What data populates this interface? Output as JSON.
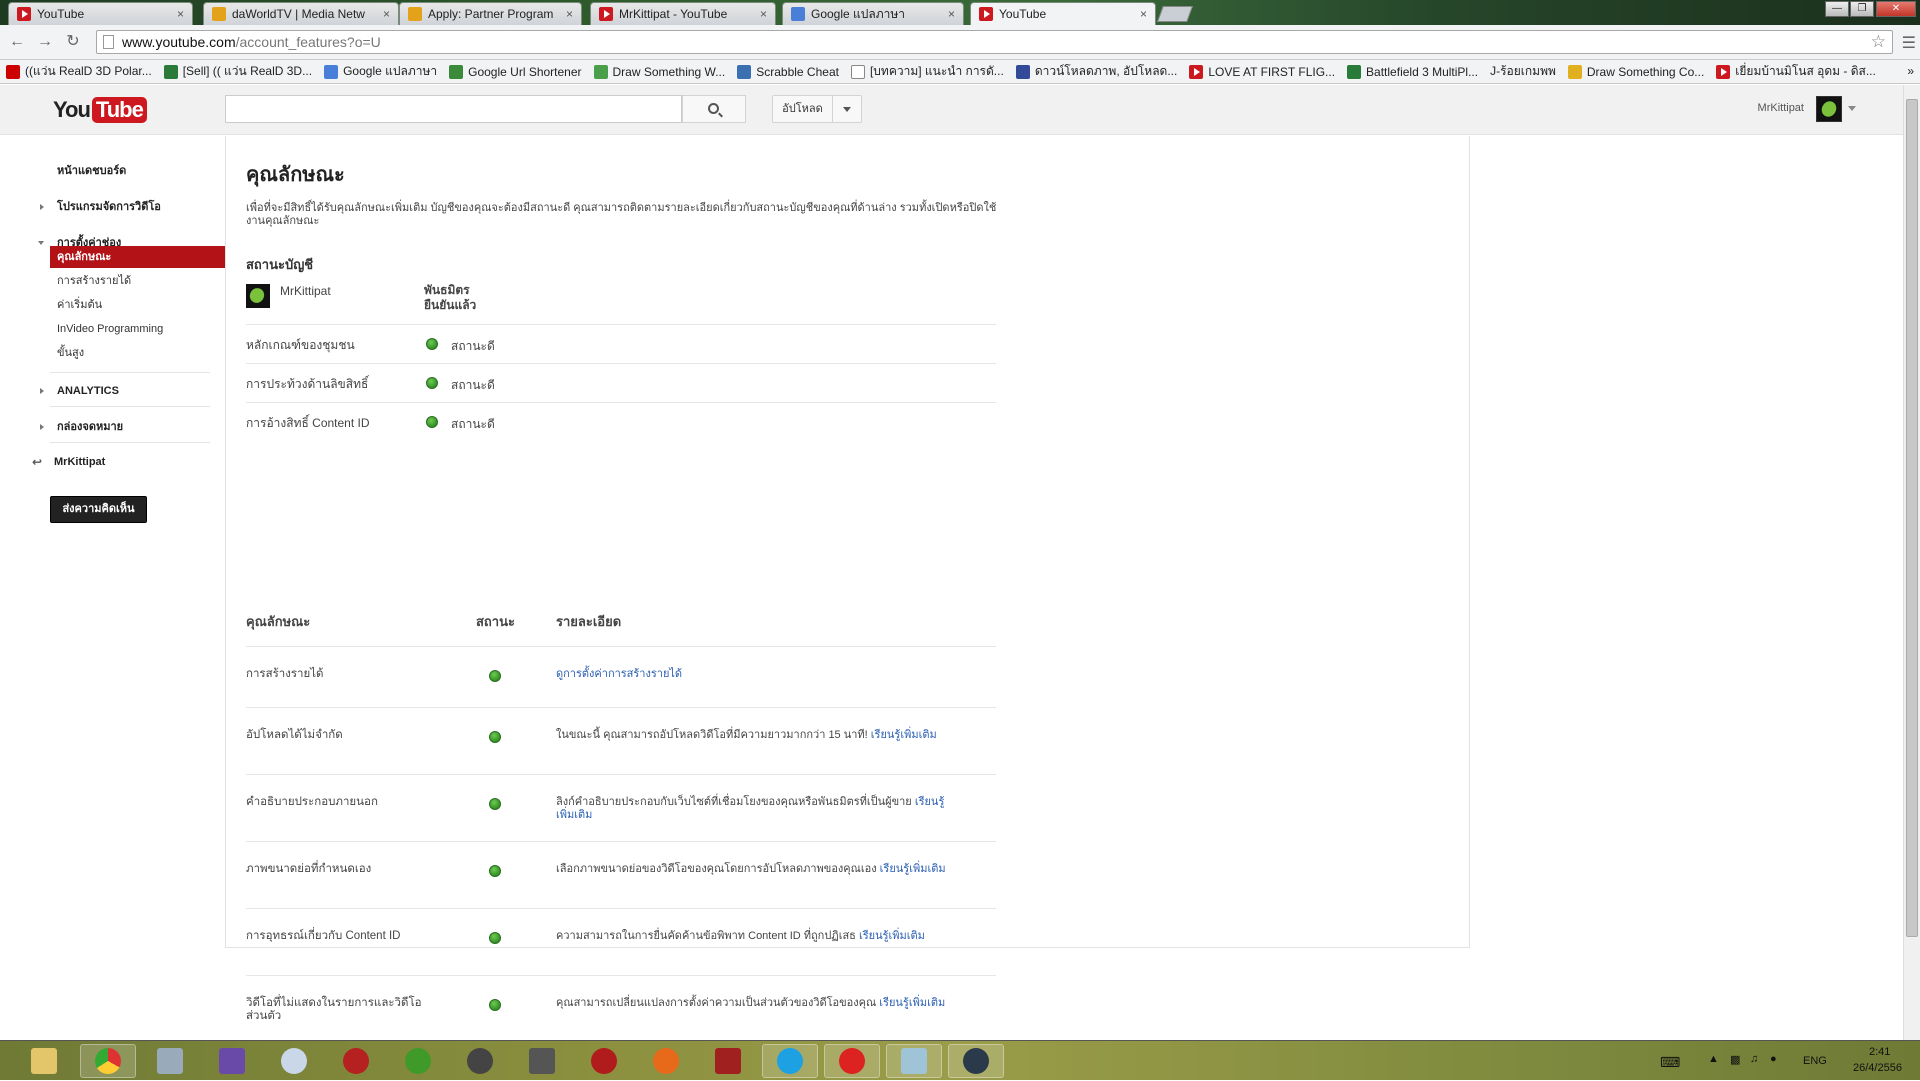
{
  "browser": {
    "tabs": [
      {
        "title": "YouTube",
        "favicon": "youtube-icon",
        "active": false
      },
      {
        "title": "daWorldTV | Media Netw",
        "favicon": "play-icon",
        "active": false
      },
      {
        "title": "Apply: Partner Program",
        "favicon": "play-icon",
        "active": false
      },
      {
        "title": "MrKittipat - YouTube",
        "favicon": "youtube-icon",
        "active": false
      },
      {
        "title": "Google แปลภาษา",
        "favicon": "google-translate-icon",
        "active": false
      },
      {
        "title": "YouTube",
        "favicon": "youtube-icon",
        "active": true
      }
    ],
    "tab_close": "×",
    "window_controls": {
      "minimize": "—",
      "maximize": "❐",
      "close": "✕"
    },
    "url_host": "www.youtube.com",
    "url_path": "/account_features?o=U",
    "bookmarks": [
      "((แว่น RealD 3D Polar...",
      "[Sell] (( แว่น RealD 3D...",
      "Google แปลภาษา",
      "Google Url Shortener",
      "Draw Something W...",
      "Scrabble Cheat",
      "[บทความ] แนะนำ การดั...",
      "ดาวน์โหลดภาพ, อัปโหลด...",
      "LOVE AT FIRST FLIG...",
      "Battlefield 3 MultiPl...",
      "J-ร้อยเกมพพ",
      "Draw Something Co...",
      "เยี่ยมบ้านมิโนส อุดม - ดิส..."
    ],
    "bookmarks_more": "»"
  },
  "youtube": {
    "logo_you": "You",
    "logo_tube": "Tube",
    "upload_label": "อัปโหลด",
    "username": "MrKittipat"
  },
  "sidebar": {
    "dashboard": "หน้าแดชบอร์ด",
    "video_manager": "โปรแกรมจัดการวิดีโอ",
    "channel_settings": "การตั้งค่าช่อง",
    "sub_items": [
      "คุณลักษณะ",
      "การสร้างรายได้",
      "ค่าเริ่มต้น",
      "InVideo Programming",
      "ขั้นสูง"
    ],
    "analytics": "ANALYTICS",
    "inbox": "กล่องจดหมาย",
    "back_user": "MrKittipat",
    "feedback": "ส่งความคิดเห็น"
  },
  "content": {
    "title": "คุณลักษณะ",
    "description": "เพื่อที่จะมีสิทธิ์ได้รับคุณลักษณะเพิ่มเติม บัญชีของคุณจะต้องมีสถานะดี คุณสามารถติดตามรายละเอียดเกี่ยวกับสถานะบัญชีของคุณที่ด้านล่าง รวมทั้งเปิดหรือปิดใช้งานคุณลักษณะ",
    "account_status_heading": "สถานะบัญชี",
    "account_name": "MrKittipat",
    "account_partner_line1": "พันธมิตร",
    "account_partner_line2": "ยืนยันแล้ว",
    "status_rows": [
      {
        "label": "หลักเกณฑ์ของชุมชน",
        "status": "สถานะดี"
      },
      {
        "label": "การประท้วงด้านลิขสิทธิ์",
        "status": "สถานะดี"
      },
      {
        "label": "การอ้างสิทธิ์ Content ID",
        "status": "สถานะดี"
      }
    ],
    "table_headers": {
      "feature": "คุณลักษณะ",
      "status": "สถานะ",
      "details": "รายละเอียด"
    },
    "features": [
      {
        "name": "การสร้างรายได้",
        "desc": "",
        "link": "ดูการตั้งค่าการสร้างรายได้"
      },
      {
        "name": "อัปโหลดได้ไม่จำกัด",
        "desc": "ในขณะนี้ คุณสามารถอัปโหลดวิดีโอที่มีความยาวมากกว่า 15 นาที! ",
        "link": "เรียนรู้เพิ่มเติม"
      },
      {
        "name": "คำอธิบายประกอบภายนอก",
        "desc": "ลิงก์คำอธิบายประกอบกับเว็บไซต์ที่เชื่อมโยงของคุณหรือพันธมิตรที่เป็นผู้ขาย ",
        "link": "เรียนรู้เพิ่มเติม"
      },
      {
        "name": "ภาพขนาดย่อที่กำหนดเอง",
        "desc": "เลือกภาพขนาดย่อของวิดีโอของคุณโดยการอัปโหลดภาพของคุณเอง ",
        "link": "เรียนรู้เพิ่มเติม"
      },
      {
        "name": "การอุทธรณ์เกี่ยวกับ Content ID",
        "desc": "ความสามารถในการยื่นคัดค้านข้อพิพาท Content ID ที่ถูกปฏิเสธ ",
        "link": "เรียนรู้เพิ่มเติม"
      },
      {
        "name": "วิดีโอที่ไม่แสดงในรายการและวิดีโอส่วนตัว",
        "desc": "คุณสามารถเปลี่ยนแปลงการตั้งค่าความเป็นส่วนตัวของวิดีโอของคุณ ",
        "link": "เรียนรู้เพิ่มเติม"
      }
    ]
  },
  "taskbar": {
    "language": "ENG",
    "time": "2:41",
    "date": "26/4/2556"
  },
  "colors": {
    "youtube_red": "#cc181e",
    "active_nav": "#b31217",
    "status_green": "#3a9a2a",
    "link_blue": "#2b5fb3"
  }
}
